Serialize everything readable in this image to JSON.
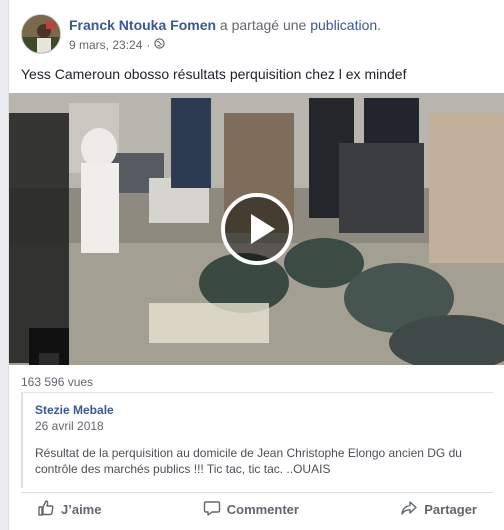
{
  "post": {
    "author": "Franck Ntouka Fomen",
    "shared_text": "a partagé une",
    "publication_link": "publication.",
    "timestamp": "9 mars, 23:24",
    "separator": "·",
    "privacy_icon": "globe-icon",
    "text": "Yess Cameroun obosso résultats perquisition chez l ex mindef"
  },
  "video": {
    "views": "163 596 vues",
    "play_icon": "play-icon"
  },
  "shared_post": {
    "author": "Stezie Mebale",
    "date": "26 avril 2018",
    "text": "Résultat de la perquisition au domicile de Jean Christophe Elongo ancien DG du contrôle des marchés publics !!! Tic tac, tic tac. ..OUAIS"
  },
  "actions": {
    "like": "J’aime",
    "comment": "Commenter",
    "share": "Partager"
  },
  "colors": {
    "link": "#385898",
    "secondary_text": "#616770",
    "background": "#e9ebee"
  }
}
